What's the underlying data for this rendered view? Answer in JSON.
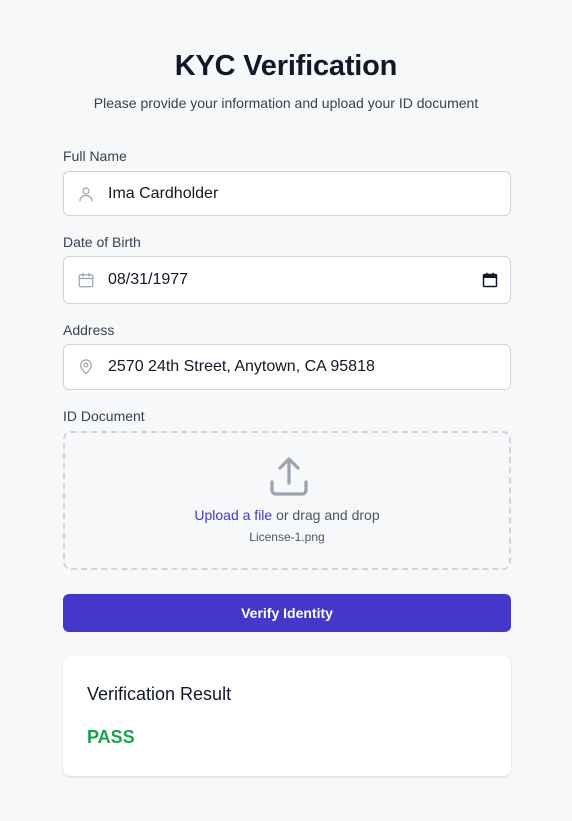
{
  "page": {
    "title": "KYC Verification",
    "subtitle": "Please provide your information and upload your ID document"
  },
  "form": {
    "full_name": {
      "label": "Full Name",
      "value": "Ima Cardholder",
      "icon": "user-icon"
    },
    "dob": {
      "label": "Date of Birth",
      "value": "08/31/1977",
      "icon": "calendar-icon"
    },
    "address": {
      "label": "Address",
      "value": "2570 24th Street, Anytown, CA 95818",
      "icon": "location-pin-icon"
    },
    "id_document": {
      "label": "ID Document",
      "upload_link": "Upload a file",
      "drag_text": " or drag and drop",
      "file_name": "License-1.png",
      "icon": "upload-icon"
    },
    "submit_label": "Verify Identity"
  },
  "result": {
    "title": "Verification Result",
    "status": "PASS",
    "status_color": "#16a34a"
  },
  "colors": {
    "accent": "#4338ca",
    "background": "#f7f8fa"
  }
}
